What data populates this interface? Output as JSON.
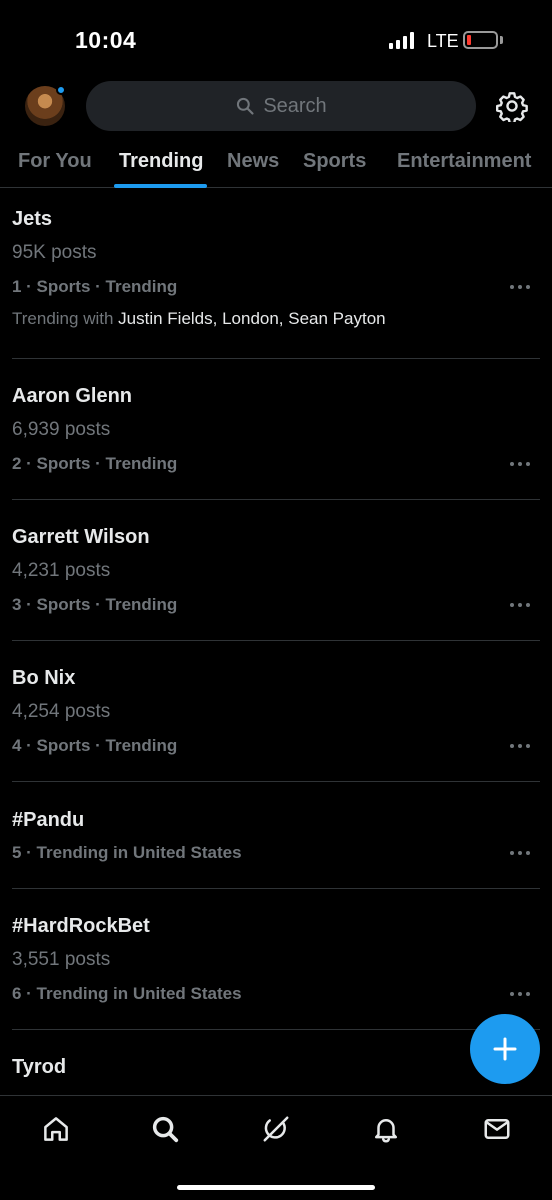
{
  "status": {
    "time": "10:04",
    "network": "LTE",
    "battery_color": "#ff3b30"
  },
  "header": {
    "search_placeholder": "Search",
    "avatar_badge_color": "#1d9bf0"
  },
  "tabs": [
    {
      "label": "For You",
      "active": false
    },
    {
      "label": "Trending",
      "active": true
    },
    {
      "label": "News",
      "active": false
    },
    {
      "label": "Sports",
      "active": false
    },
    {
      "label": "Entertainment",
      "active": false
    }
  ],
  "trends": [
    {
      "title": "Jets",
      "posts": "95K posts",
      "meta": "1 · Sports · Trending",
      "trending_with_label": "Trending with",
      "trending_with_names": "Justin Fields, London, Sean Payton"
    },
    {
      "title": "Aaron Glenn",
      "posts": "6,939 posts",
      "meta": "2 · Sports · Trending"
    },
    {
      "title": "Garrett Wilson",
      "posts": "4,231 posts",
      "meta": "3 · Sports · Trending"
    },
    {
      "title": "Bo Nix",
      "posts": "4,254 posts",
      "meta": "4 · Sports · Trending"
    },
    {
      "title": "#Pandu",
      "meta": "5 · Trending in United States"
    },
    {
      "title": "#HardRockBet",
      "posts": "3,551 posts",
      "meta": "6 · Trending in United States"
    },
    {
      "title": "Tyrod"
    }
  ],
  "colors": {
    "accent": "#1d9bf0",
    "background": "#000000",
    "secondary_text": "#71767b"
  },
  "bottom_nav": [
    {
      "icon": "home-icon"
    },
    {
      "icon": "search-icon"
    },
    {
      "icon": "grok-icon"
    },
    {
      "icon": "bell-icon"
    },
    {
      "icon": "mail-icon"
    }
  ]
}
